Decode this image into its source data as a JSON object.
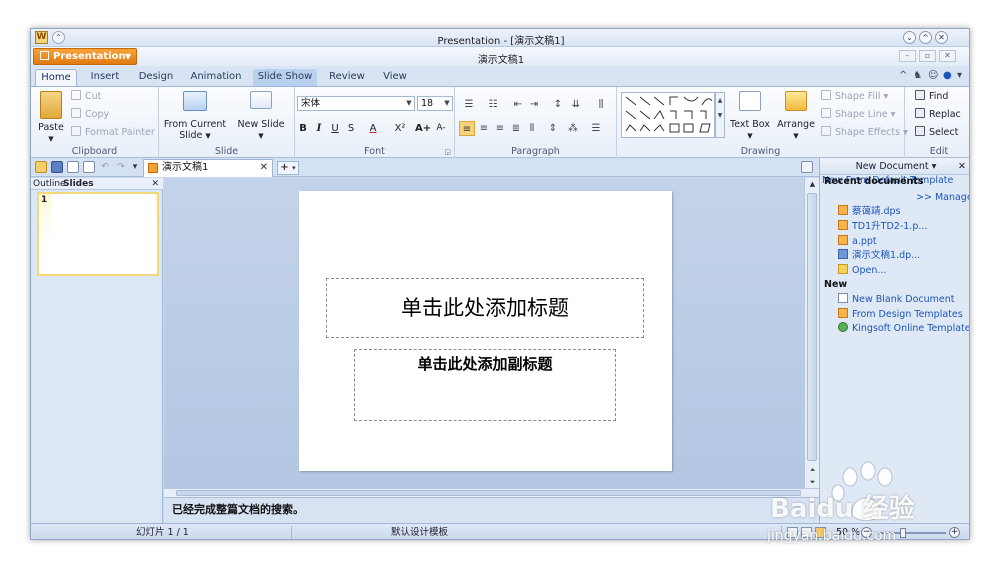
{
  "titlebar": {
    "title": "Presentation - [演示文稿1]"
  },
  "appbar": {
    "menu_label": "Presentation",
    "doc_title": "演示文稿1"
  },
  "tabs": [
    "Home",
    "Insert",
    "Design",
    "Animation",
    "Slide Show",
    "Review",
    "View"
  ],
  "active_tab": "Home",
  "ribbon": {
    "clipboard": {
      "label": "Clipboard",
      "paste": "Paste",
      "cut": "Cut",
      "copy": "Copy",
      "format_painter": "Format Painter"
    },
    "slide": {
      "label": "Slide",
      "from_current_1": "From Current",
      "from_current_2": "Slide",
      "new_slide_1": "New Slide"
    },
    "font": {
      "label": "Font",
      "font_name": "宋体",
      "font_size": "18",
      "bold": "B",
      "italic": "I",
      "underline": "U",
      "strike": "S",
      "font_color": "A",
      "superscript": "X²",
      "grow": "A+",
      "shrink": "A-"
    },
    "paragraph": {
      "label": "Paragraph"
    },
    "drawing": {
      "label": "Drawing",
      "text_box": "Text Box",
      "arrange": "Arrange",
      "shape_fill": "Shape Fill",
      "shape_line": "Shape Line",
      "shape_effects": "Shape Effects"
    },
    "edit": {
      "label": "Edit",
      "find": "Find",
      "replace": "Replac",
      "select": "Select"
    }
  },
  "document_tab": {
    "name": "演示文稿1"
  },
  "left_pane": {
    "tab_outline": "Outline",
    "tab_slides": "Slides",
    "slide_number": "1"
  },
  "slide": {
    "title_placeholder": "单击此处添加标题",
    "subtitle_placeholder": "单击此处添加副标题"
  },
  "notes_text": "已经完成整篇文档的搜索。",
  "task_pane": {
    "header": "New Document",
    "overlap_text": "New From Default Template",
    "recent_title": "Recent documents",
    "manage": ">> Manage",
    "recent": [
      "蔡蔼靖.dps",
      "TD1升TD2-1.p...",
      "a.ppt",
      "演示文稿1.dp...",
      "Open..."
    ],
    "new_title": "New",
    "new_items": [
      "New Blank Document",
      "From Design Templates",
      "Kingsoft Online Template"
    ]
  },
  "status": {
    "slide_counter": "幻灯片 1 / 1",
    "template": "默认设计模板",
    "zoom": "50 %"
  },
  "watermark": {
    "text": "jingyan.baidu.com",
    "logo": "Baidu 经验"
  }
}
